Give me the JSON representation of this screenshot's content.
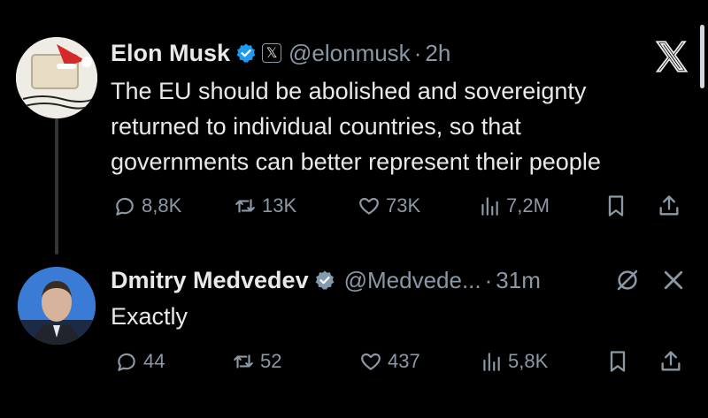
{
  "tweet": {
    "author_name": "Elon Musk",
    "affiliate_badge": "𝕏",
    "handle": "@elonmusk",
    "separator": "·",
    "time": "2h",
    "body_lines": [
      "The EU should be abolished and sovereignty",
      "returned to individual countries, so that",
      "governments can better represent their people"
    ],
    "replies": "8,8K",
    "reposts": "13K",
    "likes": "73K",
    "views": "7,2M"
  },
  "reply": {
    "author_name": "Dmitry Medvedev",
    "handle": "@Medvede...",
    "separator": "·",
    "time": "31m",
    "body": "Exactly",
    "replies": "44",
    "reposts": "52",
    "likes": "437",
    "views": "5,8K"
  },
  "colors": {
    "background": "#000000",
    "text": "#e7e9ea",
    "muted": "#8b98a5",
    "verified_blue": "#1d9bf0",
    "verified_gray": "#829aab"
  },
  "icons": [
    "x-logo-icon",
    "verified-icon",
    "reply-icon",
    "repost-icon",
    "like-icon",
    "views-icon",
    "bookmark-icon",
    "share-icon",
    "grok-icon",
    "close-icon"
  ]
}
